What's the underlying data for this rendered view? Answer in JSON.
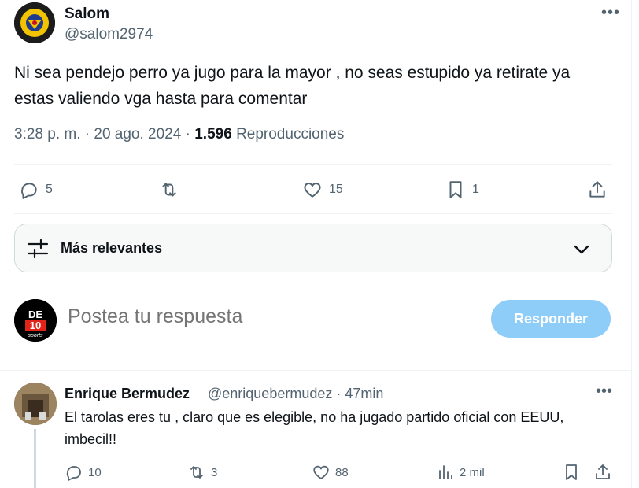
{
  "tweet": {
    "author_name": "Salom",
    "author_handle": "@salom2974",
    "more": "•••",
    "text": "Ni sea pendejo perro ya jugo para la mayor , no seas estupido ya retirate ya estas valiendo vga hasta para comentar",
    "time": "3:28 p. m.",
    "date": "20 ago. 2024",
    "views": "1.596",
    "views_label": "Reproducciones",
    "replies": "5",
    "retweets": "",
    "likes": "15",
    "bookmarks": "1"
  },
  "sort": {
    "label": "Más relevantes"
  },
  "compose": {
    "placeholder": "Postea tu respuesta",
    "avatar_text_top": "DE",
    "avatar_text_mid": "10",
    "avatar_text_bottom": "sports",
    "button": "Responder"
  },
  "reply": {
    "author_name": "Enrique Bermudez",
    "author_handle": "@enriquebermudez · 47min",
    "more": "•••",
    "text": "El tarolas eres tu , claro que es elegible, no ha jugado partido oficial con EEUU, imbecil!!",
    "replies": "10",
    "retweets": "3",
    "likes": "88",
    "views": "2 mil"
  },
  "colors": {
    "accent_disabled": "#8ecdf8",
    "secondary_text": "#536471",
    "primary_text": "#0f1419"
  },
  "icons": [
    "reply-icon",
    "retweet-icon",
    "like-icon",
    "bookmark-icon",
    "share-icon",
    "sort-sliders-icon",
    "chevron-down-icon",
    "more-icon",
    "views-icon"
  ]
}
